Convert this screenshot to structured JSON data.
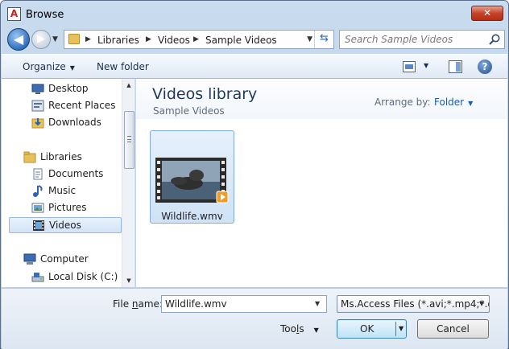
{
  "window": {
    "title": "Browse",
    "app_icon": "A",
    "close_glyph": "✕"
  },
  "nav": {
    "back_glyph": "◀",
    "forward_glyph": "▶"
  },
  "address": {
    "breadcrumbs": [
      "Libraries",
      "Videos",
      "Sample Videos"
    ]
  },
  "search": {
    "placeholder": "Search Sample Videos"
  },
  "toolbar": {
    "organize_label": "Organize",
    "new_folder_label": "New folder",
    "help_glyph": "?"
  },
  "sidebar": {
    "items": [
      {
        "label": "Desktop",
        "icon": "desktop-icon",
        "selected": false
      },
      {
        "label": "Recent Places",
        "icon": "recent-places-icon",
        "selected": false
      },
      {
        "label": "Downloads",
        "icon": "downloads-icon",
        "selected": false
      },
      {
        "label": "Libraries",
        "icon": "libraries-icon",
        "selected": false
      },
      {
        "label": "Documents",
        "icon": "documents-icon",
        "selected": false
      },
      {
        "label": "Music",
        "icon": "music-icon",
        "selected": false
      },
      {
        "label": "Pictures",
        "icon": "pictures-icon",
        "selected": false
      },
      {
        "label": "Videos",
        "icon": "videos-icon",
        "selected": true
      },
      {
        "label": "Computer",
        "icon": "computer-icon",
        "selected": false
      },
      {
        "label": "Local Disk (C:)",
        "icon": "local-disk-icon",
        "selected": false
      }
    ]
  },
  "library": {
    "title": "Videos library",
    "subtitle": "Sample Videos",
    "arrange_label": "Arrange by:",
    "arrange_value": "Folder"
  },
  "files": [
    {
      "name": "Wildlife.wmv",
      "icon": "video-thumbnail-icon"
    }
  ],
  "footer": {
    "file_name_label_pre": "File ",
    "file_name_label_u": "n",
    "file_name_label_post": "ame:",
    "file_name_value": "Wildlife.wmv",
    "file_type_value": "Ms.Access Files (*.avi;*.mp4;*.d",
    "tools_label_pre": "Too",
    "tools_label_u": "l",
    "tools_label_post": "s",
    "ok_label": "OK",
    "cancel_label": "Cancel"
  },
  "colors": {
    "accent": "#1e5ba8",
    "title_bar": "#c9dbee",
    "close": "#c7432b"
  }
}
